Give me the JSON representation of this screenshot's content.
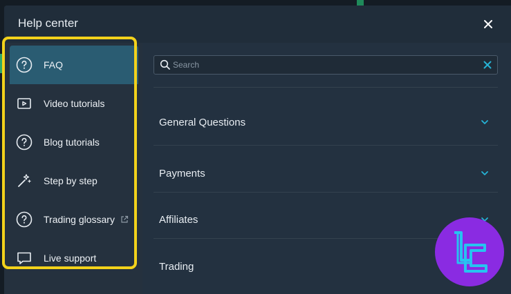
{
  "modal": {
    "title": "Help center",
    "close_label": "×"
  },
  "sidebar": {
    "items": [
      {
        "label": "FAQ",
        "icon": "question-circle-icon",
        "active": true
      },
      {
        "label": "Video tutorials",
        "icon": "video-icon",
        "active": false
      },
      {
        "label": "Blog tutorials",
        "icon": "question-circle-icon",
        "active": false
      },
      {
        "label": "Step by step",
        "icon": "magic-wand-icon",
        "active": false
      },
      {
        "label": "Trading glossary",
        "icon": "question-circle-icon",
        "active": false,
        "external": true
      },
      {
        "label": "Live support",
        "icon": "chat-icon",
        "active": false
      }
    ]
  },
  "search": {
    "placeholder": "Search",
    "value": ""
  },
  "faq": {
    "sections": [
      {
        "label": "General Questions"
      },
      {
        "label": "Payments"
      },
      {
        "label": "Affiliates"
      },
      {
        "label": "Trading"
      }
    ]
  },
  "colors": {
    "accent": "#26b3d6",
    "highlight_border": "#f3d21b",
    "active_bg": "#2a5c72",
    "logo_bg": "#8a2be2",
    "logo_stroke": "#27c3f0"
  }
}
